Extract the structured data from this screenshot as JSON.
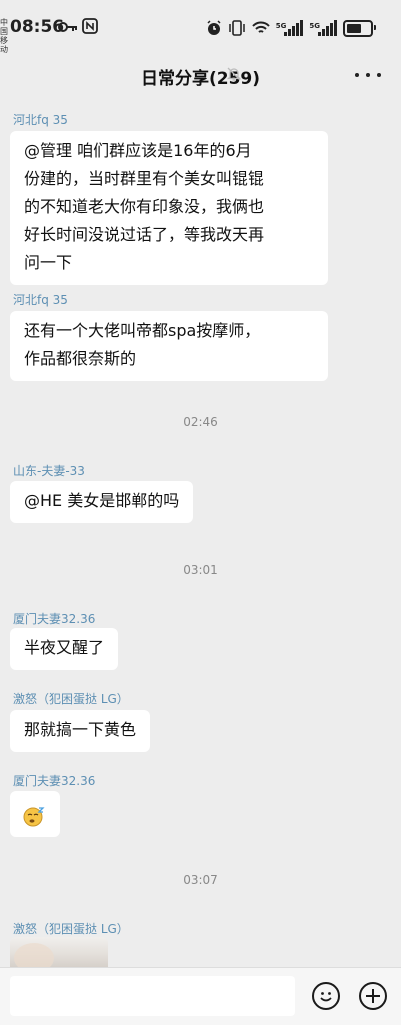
{
  "status_bar": {
    "carrier": "中国移动",
    "time": "08:56",
    "net_left": "5G",
    "net_right": "5G"
  },
  "header": {
    "title": "日常分享(259)"
  },
  "messages": [
    {
      "sender": "河北fq 35",
      "text": "@管理  咱们群应该是16年的6月\n份建的，当时群里有个美女叫锟锟\n的不知道老大你有印象没，我俩也\n好长时间没说过话了，等我改天再\n问一下"
    },
    {
      "sender": "河北fq 35",
      "text": "还有一个大佬叫帝都spa按摩师，\n作品都很奈斯的"
    },
    {
      "time": "02:46"
    },
    {
      "sender": "山东-夫妻-33",
      "text": "@HE 美女是邯郸的吗"
    },
    {
      "time": "03:01"
    },
    {
      "sender": "厦门夫妻32.36",
      "text": "半夜又醒了"
    },
    {
      "sender": "激怒（犯困蛋挞 LG）",
      "text": "那就搞一下黄色"
    },
    {
      "sender": "厦门夫妻32.36",
      "emoji": "sleepy-face"
    },
    {
      "time": "03:07"
    },
    {
      "sender": "激怒（犯困蛋挞 LG）",
      "image": "photo-thumbnail"
    }
  ],
  "input_bar": {
    "value": "",
    "placeholder": ""
  },
  "colors": {
    "background": "#ededed",
    "sender_name": "#5d8fb3",
    "bubble": "#ffffff",
    "timestamp": "#888888"
  }
}
